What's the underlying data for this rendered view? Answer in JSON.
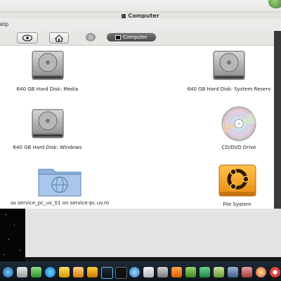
{
  "window": {
    "title": "Computer"
  },
  "menubar": {
    "help_fragment": "elp"
  },
  "toolbar": {
    "breadcrumb_label": "Computer"
  },
  "items": [
    {
      "label": "640 GB Hard Disk: Media",
      "icon": "hard-disk-icon"
    },
    {
      "label": "640 GB Hard Disk: System Reserv",
      "icon": "hard-disk-icon"
    },
    {
      "label": "640 GB Hard Disk: Windows",
      "icon": "hard-disk-icon"
    },
    {
      "label": "CD/DVD Drive",
      "icon": "cd-dvd-icon"
    },
    {
      "label": "as service_pc_uv_01 on service-pc.uv.ro",
      "icon": "network-share-icon"
    },
    {
      "label": "File System",
      "icon": "ubuntu-drive-icon"
    }
  ],
  "dock": {
    "icons": [
      "globe-icon",
      "mail-icon",
      "chat-icon",
      "skype-icon",
      "lightning-icon",
      "triangle-icon",
      "warning-icon",
      "wifi-icon",
      "terminal-icon",
      "bluetooth-icon",
      "checkbox-icon",
      "settings-icon",
      "vlc-icon",
      "tile-icon",
      "tile-icon",
      "tile-icon",
      "grid-icon",
      "dots-icon",
      "chrome-icon",
      "lifebuoy-icon"
    ]
  },
  "colors": {
    "accent_title": "#333333",
    "dock_bg": "#0c1219"
  }
}
